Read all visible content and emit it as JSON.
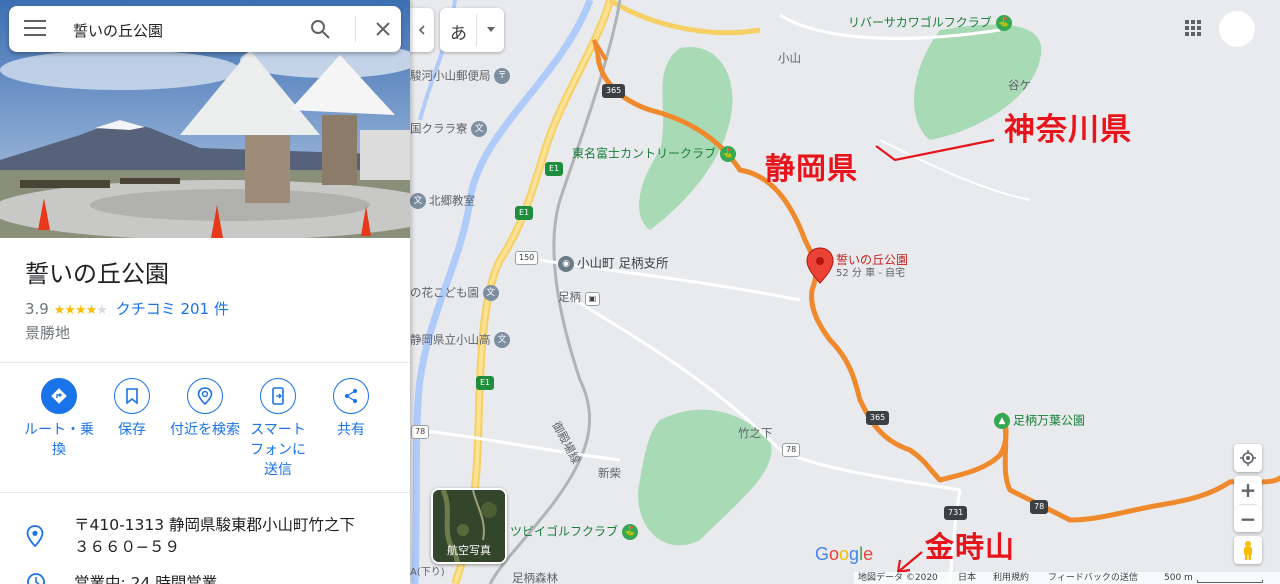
{
  "search": {
    "query": "誓いの丘公園"
  },
  "place": {
    "name": "誓いの丘公園",
    "rating": "3.9",
    "rating_value": 3.9,
    "reviews_link": "クチコミ 201 件",
    "category": "景勝地",
    "address_line1": "〒410-1313 静岡県駿東郡小山町竹之下",
    "address_line2": "３６６０−５９",
    "hours": "営業中: 24 時間営業"
  },
  "actions": [
    {
      "label": "ルート・乗換",
      "icon": "directions-icon"
    },
    {
      "label": "保存",
      "icon": "bookmark-icon"
    },
    {
      "label": "付近を検索",
      "icon": "nearby-icon"
    },
    {
      "label": "スマートフォンに送信",
      "icon": "send-to-phone-icon"
    },
    {
      "label": "共有",
      "icon": "share-icon"
    }
  ],
  "ime": {
    "char": "あ"
  },
  "map": {
    "labels": {
      "river_golf": "リバーサカワゴルフクラブ",
      "oyama_label": "小山",
      "taniga": "谷ケ",
      "post_office": "駿河小山郵便局",
      "kurara": "国クララ寮",
      "tomei_golf": "東名富士カントリークラブ",
      "kitago": "北郷教室",
      "town_office": "小山町 足柄支所",
      "kodomoen": "の花こども園",
      "ashigara_station": "足柄",
      "high_school": "静岡県立小山高",
      "takenoshita": "竹之下",
      "gotemba_line": "御殿場線",
      "shinshiba": "新柴",
      "tsubigolf": "ツビイゴルフクラブ",
      "ashigara_park": "足柄万葉公園",
      "ashigara_forest": "足柄森林",
      "kudari": "A(下り)",
      "place_pin": "誓いの丘公園",
      "route_time": "52 分 車 - 自宅"
    },
    "shields": {
      "r365a": "365",
      "r365b": "365",
      "e1a": "E1",
      "e1b": "E1",
      "e1c": "E1",
      "r150": "150",
      "r78a": "78",
      "r78b": "78",
      "r78c": "78",
      "r731": "731"
    },
    "annotations": {
      "shizuoka": "静岡県",
      "kanagawa": "神奈川県",
      "kintokizan": "金時山"
    },
    "satellite_label": "航空写真",
    "logo": "Google",
    "footer": {
      "map_data": "地図データ ©2020",
      "country": "日本",
      "terms": "利用規約",
      "feedback": "フィードバックの送信",
      "scale": "500 m"
    },
    "colors": {
      "route": "#f0892b",
      "park": "#a8dab5",
      "annotation": "#e8141b",
      "accent": "#1a73e8"
    }
  }
}
